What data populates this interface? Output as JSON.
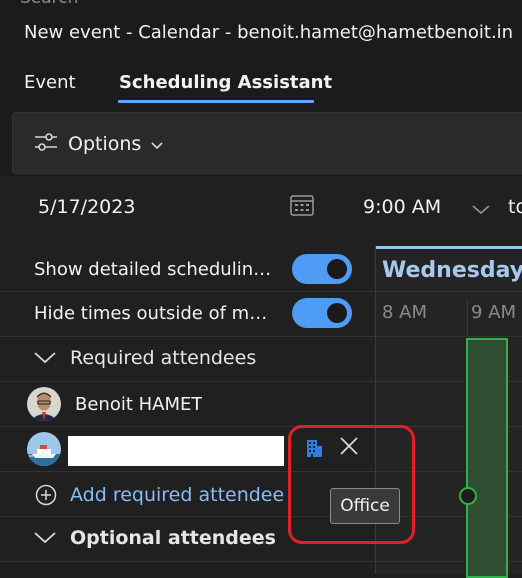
{
  "window": {
    "search_label": "Search",
    "title": "New event - Calendar - benoit.hamet@hametbenoit.in"
  },
  "tabs": [
    {
      "label": "Event",
      "active": false
    },
    {
      "label": "Scheduling Assistant",
      "active": true
    }
  ],
  "toolbar": {
    "options_label": "Options"
  },
  "datetime": {
    "date": "5/17/2023",
    "start_time": "9:00 AM",
    "to_label": "to"
  },
  "settings": {
    "show_detailed": {
      "label": "Show detailed schedulin…",
      "on": true
    },
    "hide_times": {
      "label": "Hide times outside of m…",
      "on": true
    }
  },
  "attendees": {
    "required_header": "Required attendees",
    "required": [
      {
        "name": "Benoit HAMET",
        "icon": "person-avatar"
      },
      {
        "name": "",
        "icon": "ship-avatar",
        "resource_icon": "building-icon",
        "tooltip": "Office"
      }
    ],
    "add_required_label": "Add required attendee",
    "optional_header": "Optional attendees"
  },
  "grid": {
    "day_label": "Wednesday,",
    "hours": [
      "8 AM",
      "9 AM"
    ]
  },
  "colors": {
    "accent": "#60a5ff",
    "toggle_on": "#4f9cf5",
    "link": "#86bdf6",
    "slot_border": "#2fb24a",
    "highlight": "#e0202a"
  }
}
